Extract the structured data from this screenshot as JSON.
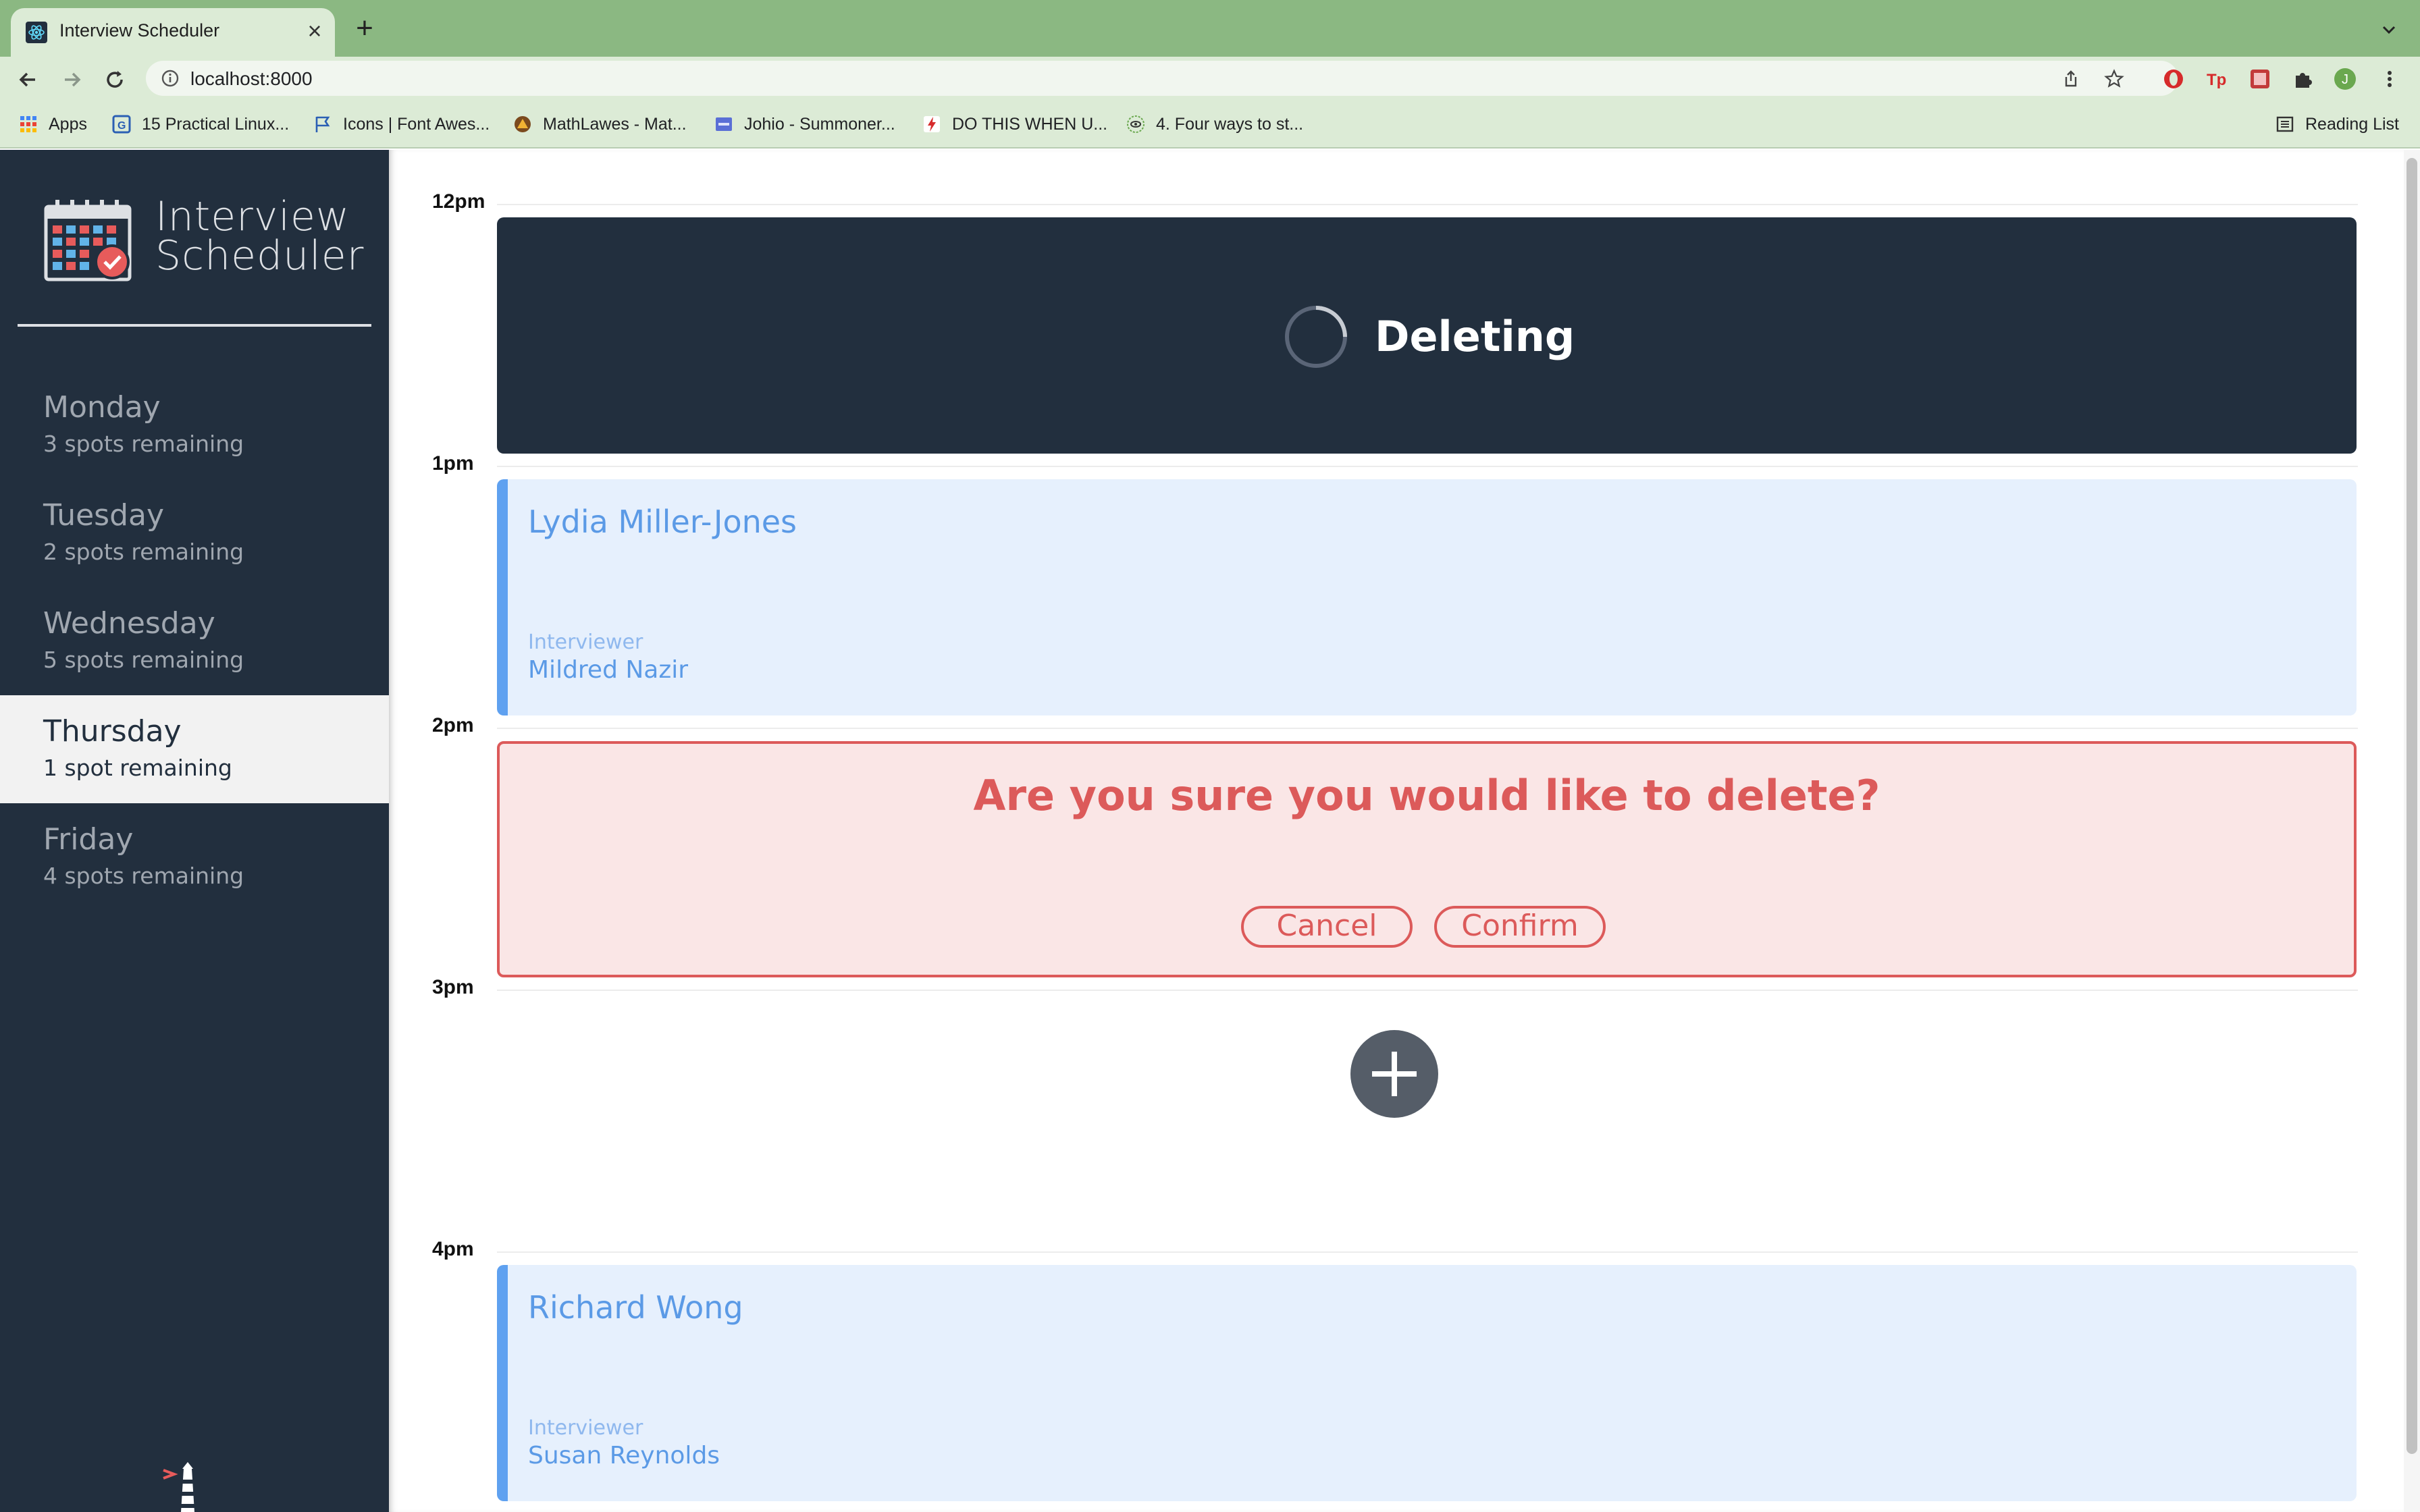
{
  "browser": {
    "tab_title": "Interview Scheduler",
    "new_tab": "+",
    "close": "×",
    "url": "localhost:8000",
    "bookmarks": [
      {
        "label": "Apps",
        "icon": "apps-grid-icon"
      },
      {
        "label": "15 Practical Linux...",
        "icon": "bookmark-site-icon"
      },
      {
        "label": "Icons | Font Awes...",
        "icon": "flag-icon"
      },
      {
        "label": "MathLawes - Mat...",
        "icon": "mathlawes-icon"
      },
      {
        "label": "Johio - Summoner...",
        "icon": "johio-icon"
      },
      {
        "label": "DO THIS WHEN U...",
        "icon": "bolt-icon"
      },
      {
        "label": "4. Four ways to st...",
        "icon": "eye-icon"
      }
    ],
    "reading_list": "Reading List",
    "profile_initial": "J"
  },
  "sidebar": {
    "brand_line1": "Interview",
    "brand_line2": "Scheduler",
    "days": [
      {
        "name": "Monday",
        "spots": "3 spots remaining",
        "selected": false
      },
      {
        "name": "Tuesday",
        "spots": "2 spots remaining",
        "selected": false
      },
      {
        "name": "Wednesday",
        "spots": "5 spots remaining",
        "selected": false
      },
      {
        "name": "Thursday",
        "spots": "1 spot remaining",
        "selected": true
      },
      {
        "name": "Friday",
        "spots": "4 spots remaining",
        "selected": false
      }
    ]
  },
  "schedule": {
    "slots": [
      {
        "time": "12pm",
        "status": "Deleting"
      },
      {
        "time": "1pm",
        "student": "Lydia Miller-Jones",
        "interviewer_label": "Interviewer",
        "interviewer": "Mildred Nazir"
      },
      {
        "time": "2pm",
        "confirm_message": "Are you sure you would like to delete?",
        "cancel": "Cancel",
        "confirm": "Confirm"
      },
      {
        "time": "3pm",
        "add_icon": "plus-icon"
      },
      {
        "time": "4pm",
        "student": "Richard Wong",
        "interviewer_label": "Interviewer",
        "interviewer": "Susan Reynolds"
      }
    ]
  },
  "colors": {
    "sidebar": "#222f3e",
    "appointment_accent": "#5fa1f0",
    "danger": "#dc5a5a",
    "browser_frame": "#8bb882"
  }
}
